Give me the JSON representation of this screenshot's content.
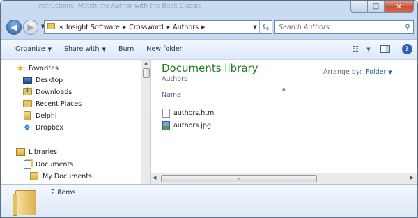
{
  "window": {
    "title": "Instructions: Match the Author with the Book Classic"
  },
  "caption_buttons": {
    "minimize": "─",
    "maximize": "□",
    "close": "✕"
  },
  "navigation": {
    "back_icon": "back-arrow-icon",
    "forward_icon": "forward-arrow-icon"
  },
  "address_bar": {
    "overflow": "«",
    "breadcrumbs": [
      "Insight Software",
      "Crossword",
      "Authors"
    ]
  },
  "search": {
    "placeholder": "Search Authors"
  },
  "toolbar": {
    "organize": "Organize",
    "share_with": "Share with",
    "burn": "Burn",
    "new_folder": "New folder"
  },
  "sidebar": {
    "favorites_header": "Favorites",
    "favorites": [
      "Desktop",
      "Downloads",
      "Recent Places",
      "Delphi",
      "Dropbox"
    ],
    "libraries_header": "Libraries",
    "libraries": [
      "Documents",
      "My Documents"
    ]
  },
  "library": {
    "title": "Documents library",
    "subtitle": "Authors",
    "arrange_label": "Arrange by:",
    "arrange_value": "Folder"
  },
  "file_list": {
    "column_name": "Name",
    "files": [
      {
        "name": "authors.htm",
        "type": "htm"
      },
      {
        "name": "authors.jpg",
        "type": "jpg"
      }
    ]
  },
  "details_pane": {
    "item_count": "2 items"
  },
  "colors": {
    "library_title": "#1e7c23",
    "accent": "#1f5eb2"
  }
}
